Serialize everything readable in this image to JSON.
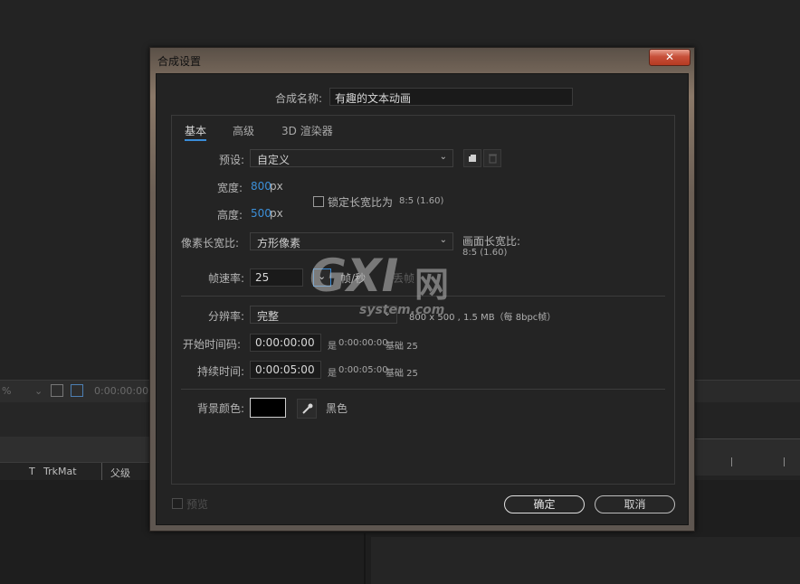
{
  "background": {
    "zoom_label": "%",
    "timecode": "0:00:00:00",
    "column_trkmat_prefix": "T",
    "column_trkmat": "TrkMat",
    "column_parent": "父级"
  },
  "dialog": {
    "title": "合成设置",
    "close_glyph": "✕",
    "comp_name_label": "合成名称:",
    "comp_name_value": "有趣的文本动画",
    "tabs": [
      {
        "label": "基本",
        "active": true
      },
      {
        "label": "高级",
        "active": false
      },
      {
        "label": "3D 渲染器",
        "active": false
      }
    ],
    "preset": {
      "label": "预设:",
      "value": "自定义"
    },
    "width": {
      "label": "宽度:",
      "value": "800",
      "unit": "px"
    },
    "height": {
      "label": "高度:",
      "value": "500",
      "unit": "px"
    },
    "lock_aspect": {
      "label": "锁定长宽比为",
      "ratio": "8:5 (1.60)",
      "checked": false
    },
    "pixel_aspect": {
      "label": "像素长宽比:",
      "value": "方形像素"
    },
    "frame_aspect": {
      "label": "画面长宽比:",
      "value": "8:5 (1.60)"
    },
    "frame_rate": {
      "label": "帧速率:",
      "value": "25",
      "unit": "帧/秒",
      "drop_frame": "丢帧"
    },
    "resolution": {
      "label": "分辨率:",
      "value": "完整",
      "info": "800 x 500 , 1.5 MB（每 8bpc帧）"
    },
    "start_timecode": {
      "label": "开始时间码:",
      "value": "0:00:00:00",
      "note_prefix": "是",
      "note_value": "0:00:00:00",
      "base": "基础 25"
    },
    "duration": {
      "label": "持续时间:",
      "value": "0:00:05:00",
      "note_prefix": "是",
      "note_value": "0:00:05:00",
      "base": "基础 25"
    },
    "bg_color": {
      "label": "背景颜色:",
      "color_name": "黑色",
      "swatch": "#000000"
    },
    "preview_label": "预览",
    "ok_label": "确定",
    "cancel_label": "取消"
  },
  "watermark": {
    "letters": "GXI",
    "cjk": "网",
    "domain": "system.com"
  },
  "colors": {
    "accent_blue": "#3a8cd8",
    "dialog_bg": "#232323",
    "close_red": "#c7503a"
  }
}
